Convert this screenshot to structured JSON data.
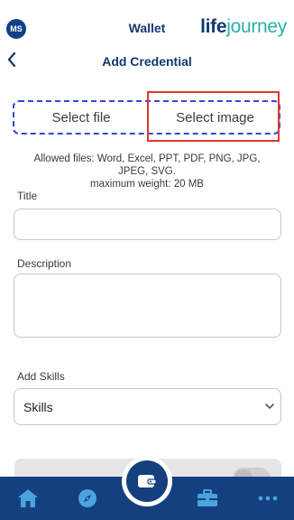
{
  "header": {
    "avatar_initials": "MS",
    "app_title": "Wallet",
    "brand_part1": "life",
    "brand_part2": "journey"
  },
  "page": {
    "title": "Add Credential",
    "select_file_label": "Select file",
    "select_image_label": "Select image",
    "allowed_line1": "Allowed files: Word, Excel, PPT, PDF, PNG, JPG,",
    "allowed_line2": "JPEG, SVG.",
    "allowed_line3": "maximum weight: 20 MB"
  },
  "form": {
    "title_label": "Title",
    "title_value": "",
    "description_label": "Description",
    "description_value": "",
    "skills_label": "Add Skills",
    "skills_selected": "Skills"
  },
  "nav": {
    "items": [
      "home-icon",
      "compass-icon",
      "wallet-icon",
      "briefcase-icon",
      "more-icon"
    ]
  },
  "colors": {
    "primary": "#15407f",
    "brand_teal": "#27b0a6",
    "dashed_border": "#2d4bd6",
    "highlight": "#e0392b"
  }
}
